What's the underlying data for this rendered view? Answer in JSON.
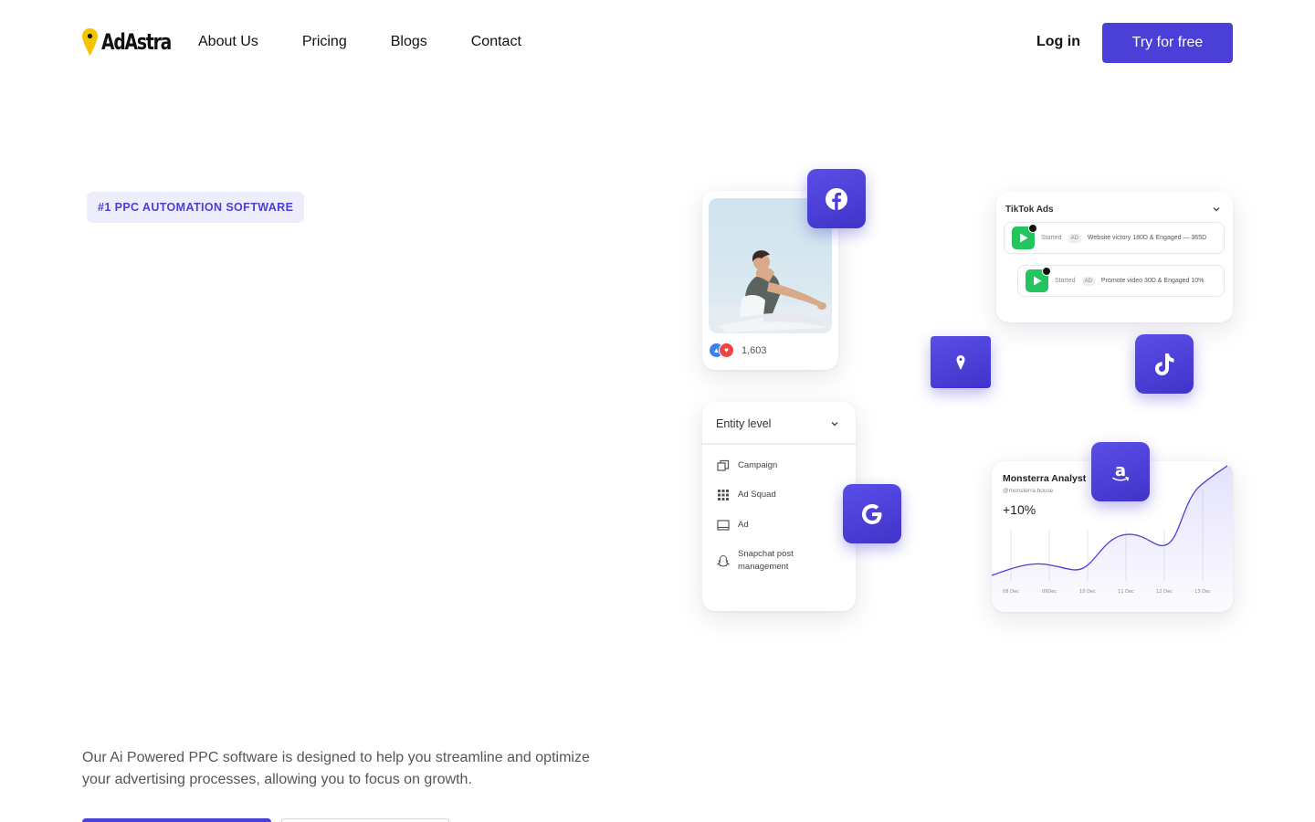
{
  "nav": {
    "logo_text": "AdAstra",
    "links": [
      "About Us",
      "Pricing",
      "Blogs",
      "Contact"
    ],
    "login_label": "Log in",
    "try_label": "Try for free"
  },
  "hero": {
    "badge": "#1 PPC AUTOMATION SOFTWARE",
    "description": "Our Ai Powered PPC software is designed to help you streamline and optimize your advertising processes, allowing you to focus on growth."
  },
  "photo_card": {
    "reaction_count": "1,603"
  },
  "tiktok_card": {
    "title": "TikTok Ads",
    "rows": [
      {
        "status": "Started",
        "tag": "AD",
        "text": "Website victory 180D & Engaged — 365D"
      },
      {
        "status": "Started",
        "tag": "AD",
        "text": "Promote video 30D & Engaged 10%"
      }
    ]
  },
  "entity_card": {
    "title": "Entity level",
    "items": [
      {
        "label": "Campaign",
        "icon": "campaign-icon"
      },
      {
        "label": "Ad Squad",
        "icon": "grid-icon"
      },
      {
        "label": "Ad",
        "icon": "ad-icon"
      },
      {
        "label": "Snapchat post management",
        "icon": "snapchat-icon"
      }
    ]
  },
  "analytics_card": {
    "title": "Monsterra Analyst",
    "handle": "@monsterra.house",
    "value": "+10%",
    "x_labels": [
      "08 Dec",
      "09Dec",
      "10 Dec",
      "11 Dec",
      "12 Dec",
      "13 Dec"
    ]
  },
  "platform_icons": [
    "facebook-icon",
    "adastra-pin-icon",
    "tiktok-icon",
    "google-icon",
    "amazon-icon"
  ],
  "colors": {
    "brand": "#4a3fd6",
    "badge_bg": "#eeedfb",
    "pin_yellow": "#f5c400",
    "tiktok_green": "#22c55e"
  }
}
